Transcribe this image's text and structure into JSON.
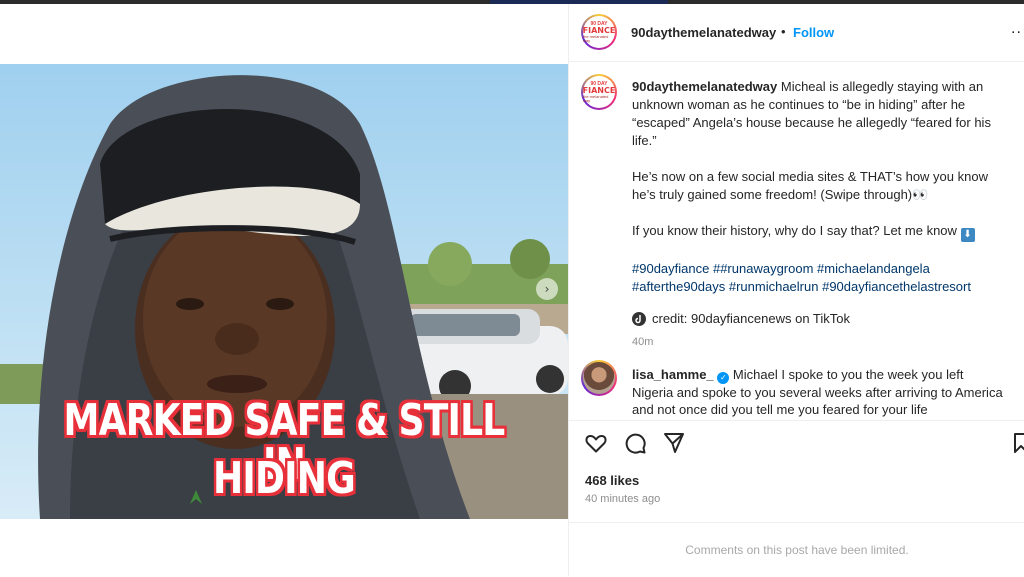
{
  "post": {
    "username": "90daythemelanatedway",
    "follow_label": "Follow",
    "separator": "•",
    "more": "..",
    "avatar": {
      "line1": "90 DAY",
      "line2": "FIANCE",
      "line3": "the melanated way"
    },
    "image_caption": {
      "line1": "MARKED SAFE & STILL IN",
      "line2": "HIDING"
    },
    "carousel_next": "›"
  },
  "caption": {
    "username": "90daythemelanatedway",
    "para1": "Micheal is allegedly staying with an unknown woman as he continues to “be in hiding” after he “escaped” Angela’s house because he allegedly “feared for his life.”",
    "para2": "He’s now on a few social media sites & THAT’s how you know he’s truly gained some freedom! (Swipe through)",
    "para2_emoji": "👀",
    "para3": "If you know their history, why do I say that? Let me know",
    "para3_emoji": "ℹ",
    "hashtags_line1": [
      "#90dayfiance",
      "##runawaygroom",
      "#michaelandangela"
    ],
    "hashtags_line2": [
      "#afterthe90days",
      "#runmichaelrun",
      "#90dayfiancethelastresort"
    ],
    "credit": "credit: 90dayfiancenews on TikTok",
    "time": "40m"
  },
  "comment": {
    "username": "lisa_hamme_",
    "text": "Michael I spoke to you the week you left Nigeria and spoke to you several weeks after arriving to America and not once did you tell me you feared for your life"
  },
  "actions": {
    "likes": "468 likes",
    "time_ago": "40 minutes ago",
    "icons": [
      "heart-icon",
      "comment-icon",
      "share-icon",
      "bookmark-icon"
    ]
  },
  "footer": {
    "limited": "Comments on this post have been limited."
  },
  "colors": {
    "link": "#0095f6",
    "hashtag": "#00376b",
    "caption_text": "#ffffff",
    "caption_outline": "#e8303a"
  }
}
